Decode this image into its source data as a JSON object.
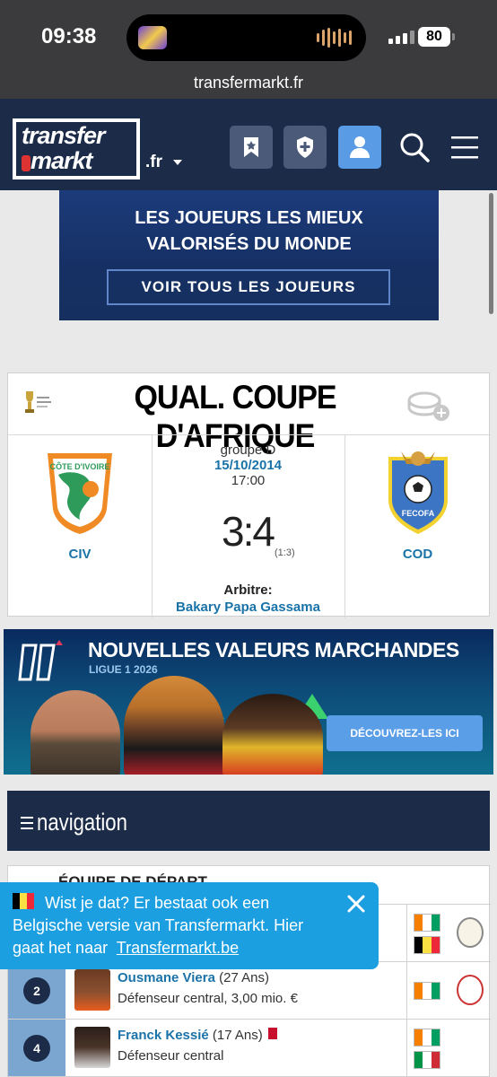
{
  "status_bar": {
    "time": "09:38",
    "battery": "80"
  },
  "browser": {
    "url": "transfermarkt.fr"
  },
  "header": {
    "logo_line1": "transfer",
    "logo_line2": "markt",
    "tld": ".fr",
    "icons": [
      "watchlist-icon",
      "shield-plus-icon",
      "user-icon",
      "search-icon",
      "menu-icon"
    ],
    "accent_color": "#5a9be5",
    "brand_color": "#1b2b48"
  },
  "promo": {
    "line1": "LES JOUEURS LES MIEUX",
    "line2": "VALORISÉS DU MONDE",
    "button": "VOIR TOUS LES JOUEURS"
  },
  "match": {
    "competition": "QUAL. COUPE D'AFRIQUE",
    "group": "groupe D",
    "date": "15/10/2014",
    "kickoff": "17:00",
    "score": "3:4",
    "halftime": "(1:3)",
    "referee_label": "Arbitre:",
    "referee": "Bakary Papa Gassama",
    "home": {
      "short": "CIV",
      "crest_text": "CÔTE D'IVOIRE"
    },
    "away": {
      "short": "COD",
      "crest_text": "FECOFA"
    }
  },
  "market_banner": {
    "title": "NOUVELLES VALEURS MARCHANDES",
    "subtitle": "LIGUE 1 2026",
    "cta": "DÉCOUVREZ-LES ICI"
  },
  "navigation": {
    "label": "navigation"
  },
  "lineup": {
    "heading": "ÉQUIPE DE DÉPART",
    "rows": [
      {
        "number": "2",
        "name": "Ousmane Viera",
        "age": "(27 Ans)",
        "position": "Défenseur central, 3,00 mio. €"
      },
      {
        "number": "4",
        "name": "Franck Kessié",
        "age": "(17 Ans)",
        "position": "Défenseur central"
      }
    ]
  },
  "toast": {
    "text": "Wist je dat? Er bestaat ook een Belgische versie van Transfermarkt. Hier gaat het naar",
    "link": "Transfermarkt.be"
  }
}
